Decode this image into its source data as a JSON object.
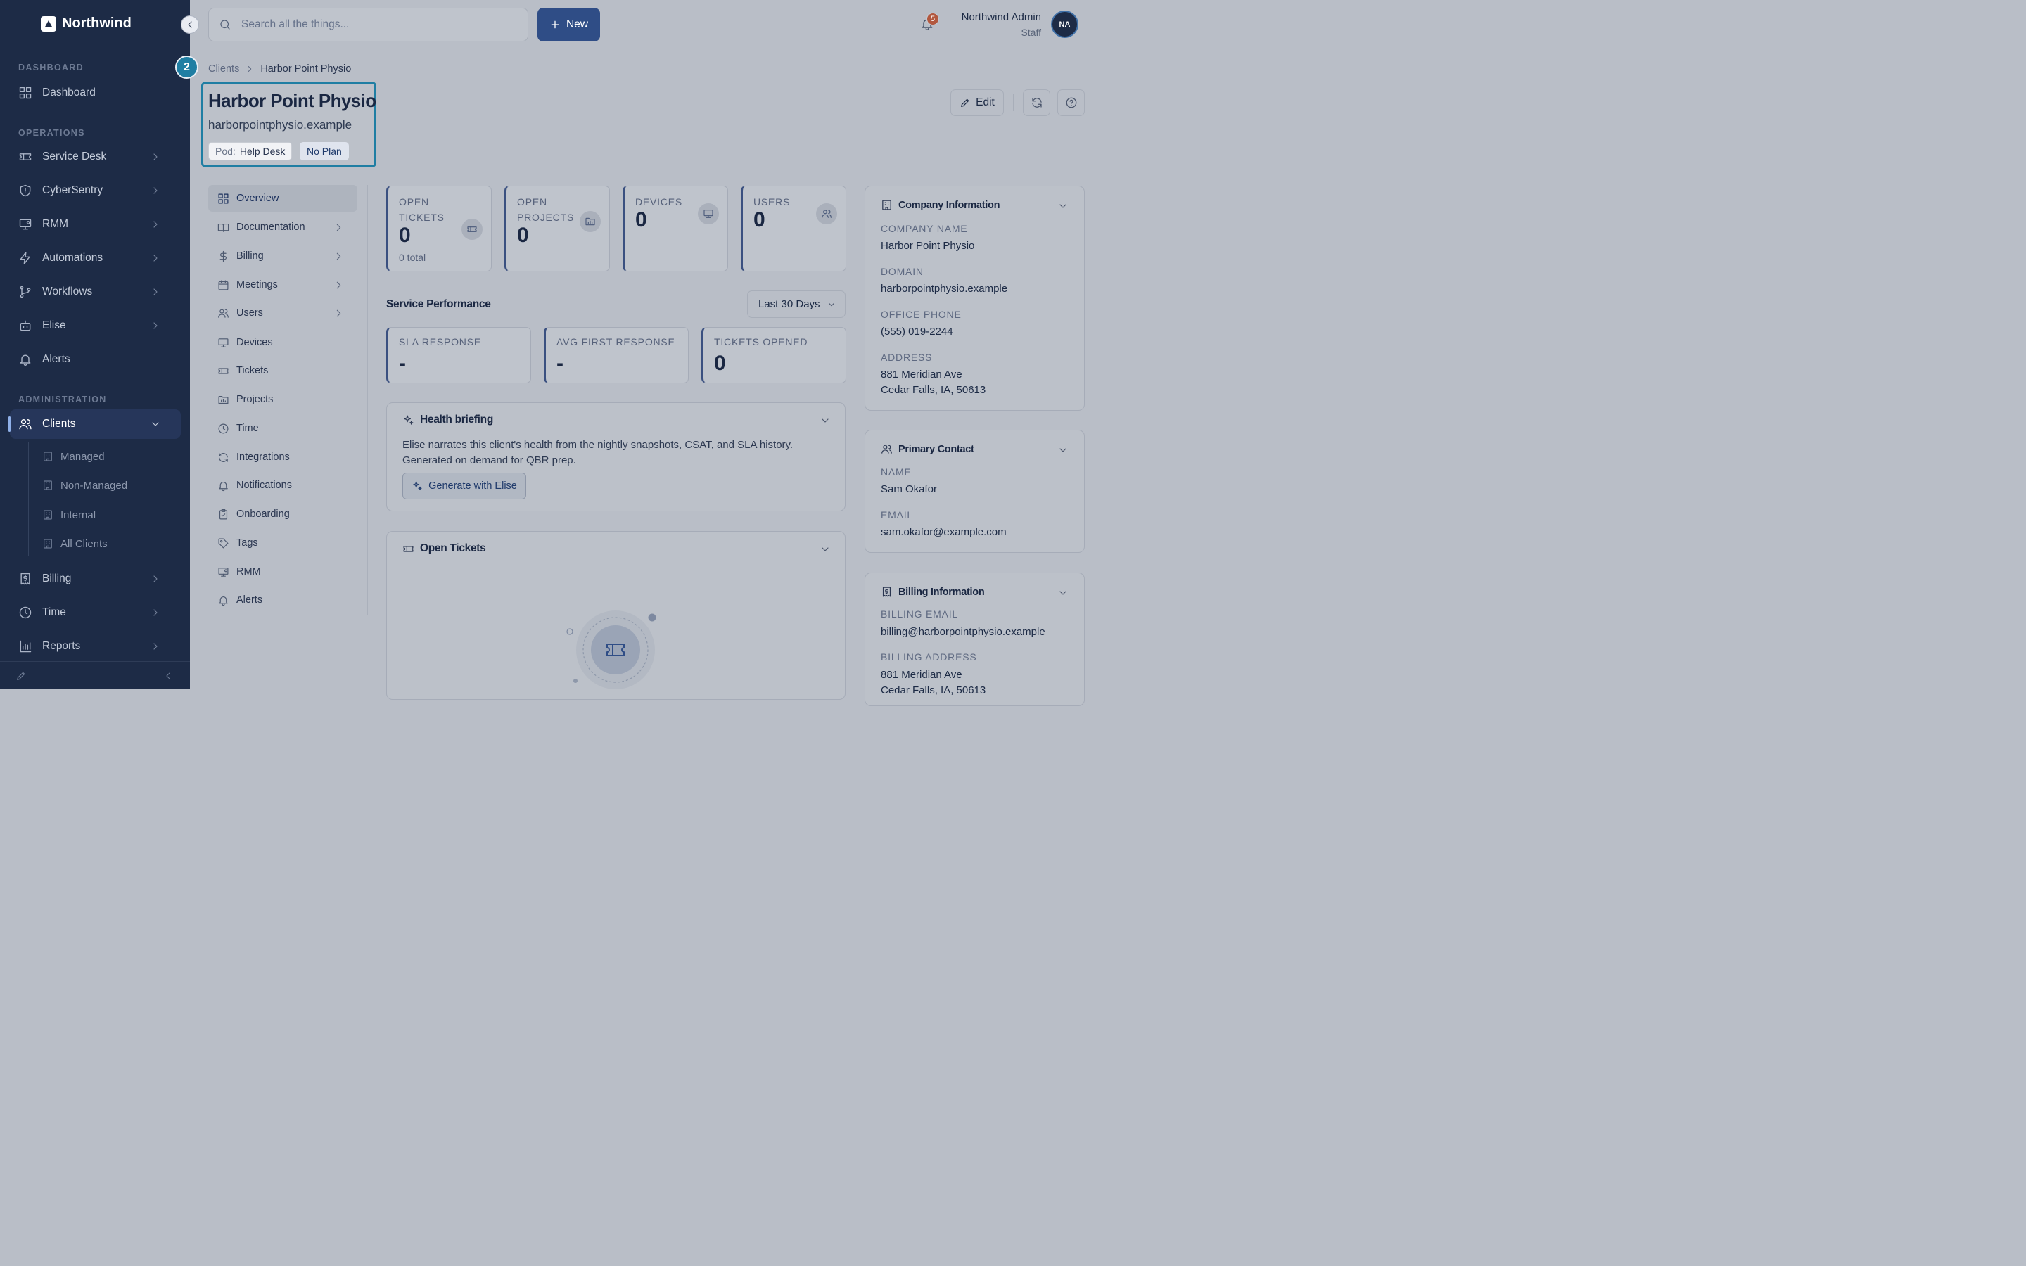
{
  "app": {
    "brand": "Northwind"
  },
  "sidebar": {
    "sections": {
      "dashboard": "DASHBOARD",
      "operations": "OPERATIONS",
      "administration": "ADMINISTRATION"
    },
    "items": {
      "dashboard": "Dashboard",
      "service_desk": "Service Desk",
      "cybersentry": "CyberSentry",
      "rmm": "RMM",
      "automations": "Automations",
      "workflows": "Workflows",
      "elise": "Elise",
      "alerts": "Alerts",
      "clients": "Clients",
      "billing": "Billing",
      "time": "Time",
      "reports": "Reports"
    },
    "clients_sub": [
      "Managed",
      "Non-Managed",
      "Internal",
      "All Clients"
    ]
  },
  "topbar": {
    "search_placeholder": "Search all the things...",
    "new_label": "New",
    "notifications_count": "5",
    "user_name": "Northwind Admin",
    "user_role": "Staff",
    "user_initials": "NA"
  },
  "header": {
    "step_badge": "2",
    "breadcrumb": {
      "root": "Clients",
      "current": "Harbor Point Physio"
    },
    "title": "Harbor Point Physio",
    "domain": "harborpointphysio.example",
    "pod_key": "Pod:",
    "pod_value": "Help Desk",
    "plan": "No Plan",
    "edit_label": "Edit"
  },
  "subnav": [
    "Overview",
    "Documentation",
    "Billing",
    "Meetings",
    "Users",
    "Devices",
    "Tickets",
    "Projects",
    "Time",
    "Integrations",
    "Notifications",
    "Onboarding",
    "Tags",
    "RMM",
    "Alerts"
  ],
  "kpis": [
    {
      "label": "OPEN TICKETS",
      "value": "0",
      "caption": "0 total"
    },
    {
      "label": "OPEN PROJECTS",
      "value": "0"
    },
    {
      "label": "DEVICES",
      "value": "0"
    },
    {
      "label": "USERS",
      "value": "0"
    }
  ],
  "service_performance": {
    "title": "Service Performance",
    "range": "Last 30 Days",
    "metrics": [
      {
        "label": "SLA RESPONSE",
        "value": "-"
      },
      {
        "label": "AVG FIRST RESPONSE",
        "value": "-"
      },
      {
        "label": "TICKETS OPENED",
        "value": "0"
      }
    ]
  },
  "health_briefing": {
    "title": "Health briefing",
    "text": "Elise narrates this client's health from the nightly snapshots, CSAT, and SLA history. Generated on demand for QBR prep.",
    "button": "Generate with Elise"
  },
  "open_tickets": {
    "title": "Open Tickets"
  },
  "company_info": {
    "title": "Company Information",
    "company_name_label": "COMPANY NAME",
    "company_name": "Harbor Point Physio",
    "domain_label": "DOMAIN",
    "domain": "harborpointphysio.example",
    "phone_label": "OFFICE PHONE",
    "phone": "(555) 019-2244",
    "address_label": "ADDRESS",
    "address_line1": "881 Meridian Ave",
    "address_line2": "Cedar Falls, IA, 50613"
  },
  "primary_contact": {
    "title": "Primary Contact",
    "name_label": "NAME",
    "name": "Sam Okafor",
    "email_label": "EMAIL",
    "email": "sam.okafor@example.com"
  },
  "billing_info": {
    "title": "Billing Information",
    "email_label": "BILLING EMAIL",
    "email": "billing@harborpointphysio.example",
    "address_label": "BILLING ADDRESS",
    "address_line1": "881 Meridian Ave",
    "address_line2": "Cedar Falls, IA, 50613"
  }
}
